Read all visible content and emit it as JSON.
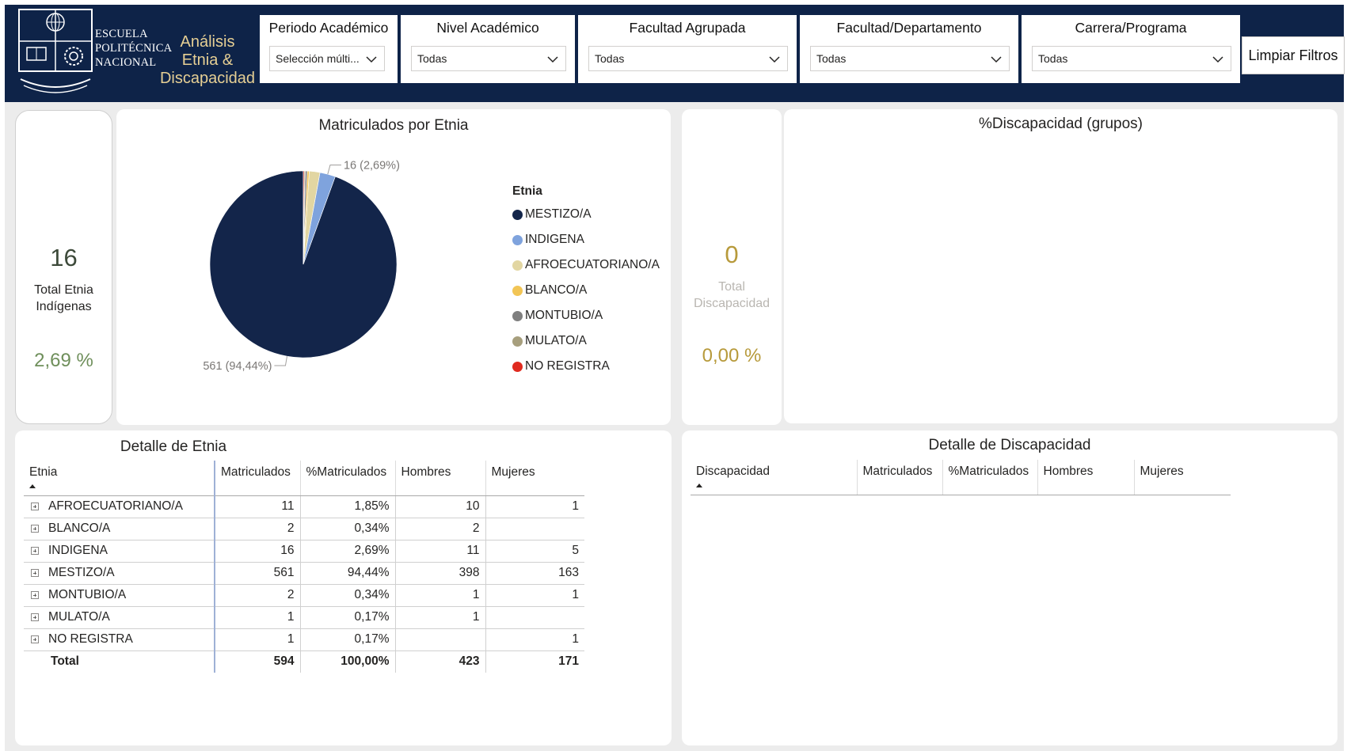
{
  "header": {
    "school_name_lines": [
      "ESCUELA",
      "POLITÉCNICA",
      "NACIONAL"
    ],
    "app_title_lines": [
      "Análisis",
      "Etnia &",
      "Discapacidad"
    ],
    "filters": [
      {
        "title": "Periodo Académico",
        "value": "Selección múlti..."
      },
      {
        "title": "Nivel Académico",
        "value": "Todas"
      },
      {
        "title": "Facultad Agrupada",
        "value": "Todas"
      },
      {
        "title": "Facultad/Departamento",
        "value": "Todas"
      },
      {
        "title": "Carrera/Programa",
        "value": "Todas"
      }
    ],
    "clear_label": "Limpiar Filtros"
  },
  "kpi_etnia": {
    "value": "16",
    "label_line1": "Total Etnia",
    "label_line2": "Indígenas",
    "percent": "2,69 %"
  },
  "kpi_disc": {
    "value": "0",
    "label_line1": "Total",
    "label_line2": "Discapacidad",
    "percent": "0,00 %"
  },
  "colors": {
    "header_bg": "#0e2348",
    "title_gold": "#e6cf94",
    "kpi_green": "#6f8f5b",
    "kpi_gold": "#b79a3b",
    "kpi_dim": "#b9b6b1"
  },
  "chart_data": {
    "type": "pie",
    "title": "Matriculados por Etnia",
    "legend_title": "Etnia",
    "legend_position": "right",
    "slices": [
      {
        "label": "MESTIZO/A",
        "value": 561,
        "color": "#13254a"
      },
      {
        "label": "INDIGENA",
        "value": 16,
        "color": "#7fa3dd"
      },
      {
        "label": "AFROECUATORIANO/A",
        "value": 11,
        "color": "#e2d6a2"
      },
      {
        "label": "BLANCO/A",
        "value": 2,
        "color": "#f2c555"
      },
      {
        "label": "MONTUBIO/A",
        "value": 2,
        "color": "#7f7f7f"
      },
      {
        "label": "MULATO/A",
        "value": 1,
        "color": "#a79f7d"
      },
      {
        "label": "NO REGISTRA",
        "value": 1,
        "color": "#e02a1f"
      }
    ],
    "data_labels": [
      {
        "slice": "INDIGENA",
        "text": "16 (2,69%)"
      },
      {
        "slice": "MESTIZO/A",
        "text": "561 (94,44%)"
      }
    ]
  },
  "disc_chart": {
    "title": "%Discapacidad (grupos)"
  },
  "etnia_table": {
    "title": "Detalle de Etnia",
    "headers": [
      "Etnia",
      "Matriculados",
      "%Matriculados",
      "Hombres",
      "Mujeres"
    ],
    "rows": [
      [
        "AFROECUATORIANO/A",
        "11",
        "1,85%",
        "10",
        "1"
      ],
      [
        "BLANCO/A",
        "2",
        "0,34%",
        "2",
        ""
      ],
      [
        "INDIGENA",
        "16",
        "2,69%",
        "11",
        "5"
      ],
      [
        "MESTIZO/A",
        "561",
        "94,44%",
        "398",
        "163"
      ],
      [
        "MONTUBIO/A",
        "2",
        "0,34%",
        "1",
        "1"
      ],
      [
        "MULATO/A",
        "1",
        "0,17%",
        "1",
        ""
      ],
      [
        "NO REGISTRA",
        "1",
        "0,17%",
        "",
        "1"
      ]
    ],
    "total": [
      "Total",
      "594",
      "100,00%",
      "423",
      "171"
    ]
  },
  "disc_table": {
    "title": "Detalle de Discapacidad",
    "headers": [
      "Discapacidad",
      "Matriculados",
      "%Matriculados",
      "Hombres",
      "Mujeres"
    ]
  }
}
